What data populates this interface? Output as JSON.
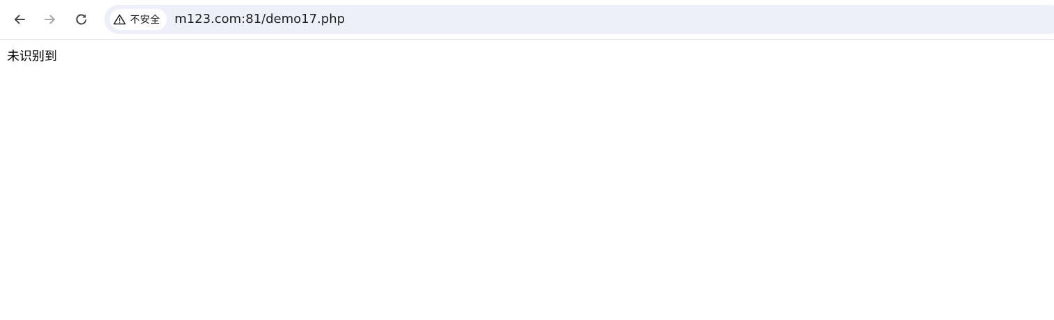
{
  "browser": {
    "nav": {
      "back_icon": "arrow-left-icon",
      "forward_icon": "arrow-right-icon",
      "forward_enabled": false,
      "reload_icon": "reload-icon"
    },
    "omnibox": {
      "security_icon": "warning-triangle-icon",
      "security_label": "不安全",
      "url": "m123.com:81/demo17.php",
      "background_color": "#edf0f8"
    }
  },
  "page": {
    "body_text": "未识别到"
  }
}
